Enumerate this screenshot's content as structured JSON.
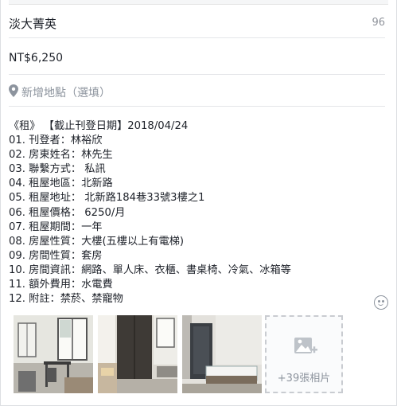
{
  "listing": {
    "title": "淡大菁英",
    "title_char_count": "96",
    "price": "NT$6,250",
    "location_placeholder": "新增地點（選填）"
  },
  "description": {
    "lines": [
      "《租》 【截止刊登日期】2018/04/24",
      "01. 刊登者：林裕欣",
      "02. 房東姓名：林先生",
      "03. 聯繫方式： 私訊",
      "04. 租屋地區：北新路",
      "05. 租屋地址： 北新路184巷33號3樓之1",
      "06. 租屋價格： 6250/月",
      "07. 租屋期間：一年",
      "08. 房屋性質：大樓(五樓以上有電梯)",
      "09. 房間性質：套房",
      "10. 房間資訊：網路、單人床、衣櫃、書桌椅、冷氣、冰箱等",
      "11. 額外費用：水電費",
      "12. 附註：禁菸、禁寵物"
    ]
  },
  "photos": {
    "more_label": "+39張相片",
    "thumbnails": [
      "room-photo-desk-window",
      "room-photo-wardrobe-bed",
      "room-photo-bed-door"
    ]
  },
  "icons": {
    "location": "location-pin-icon",
    "emoji": "emoji-smiley-icon",
    "add_photo": "add-photo-icon"
  }
}
